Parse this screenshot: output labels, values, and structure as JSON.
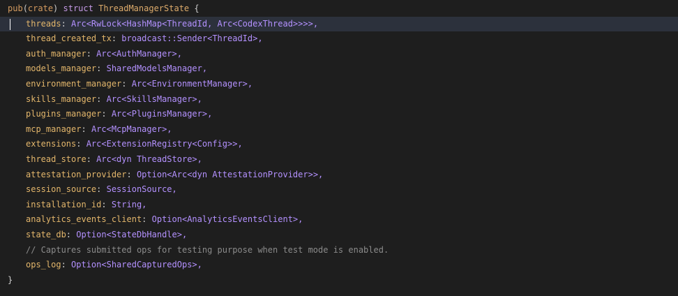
{
  "editor": {
    "header": {
      "pub": "pub",
      "crate": "crate",
      "struct": "struct",
      "name": "ThreadManagerState",
      "open": "{"
    },
    "fields": [
      {
        "name": "threads",
        "type": "Arc<RwLock<HashMap<ThreadId, Arc<CodexThread>>>>,"
      },
      {
        "name": "thread_created_tx",
        "type": "broadcast::Sender<ThreadId>,"
      },
      {
        "name": "auth_manager",
        "type": "Arc<AuthManager>,"
      },
      {
        "name": "models_manager",
        "type": "SharedModelsManager,"
      },
      {
        "name": "environment_manager",
        "type": "Arc<EnvironmentManager>,"
      },
      {
        "name": "skills_manager",
        "type": "Arc<SkillsManager>,"
      },
      {
        "name": "plugins_manager",
        "type": "Arc<PluginsManager>,"
      },
      {
        "name": "mcp_manager",
        "type": "Arc<McpManager>,"
      },
      {
        "name": "extensions",
        "type": "Arc<ExtensionRegistry<Config>>,"
      },
      {
        "name": "thread_store",
        "type": "Arc<dyn ThreadStore>,"
      },
      {
        "name": "attestation_provider",
        "type": "Option<Arc<dyn AttestationProvider>>,"
      },
      {
        "name": "session_source",
        "type": "SessionSource,"
      },
      {
        "name": "installation_id",
        "type": "String,"
      },
      {
        "name": "analytics_events_client",
        "type": "Option<AnalyticsEventsClient>,"
      },
      {
        "name": "state_db",
        "type": "Option<StateDbHandle>,"
      }
    ],
    "comment": "// Captures submitted ops for testing purpose when test mode is enabled.",
    "last_field": {
      "name": "ops_log",
      "type": "Option<SharedCapturedOps>,"
    },
    "close": "}"
  }
}
